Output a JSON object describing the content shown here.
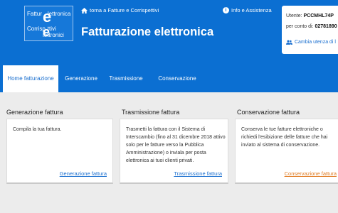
{
  "header": {
    "logo": {
      "line1": "Fattur",
      "line2": "lettronica",
      "line3": "Corrisp",
      "line4": "ttivi",
      "line5": "lettronici"
    },
    "back_link": "torna a Fatture e Corrispettivi",
    "title": "Fatturazione elettronica",
    "info_link": "Info e Assistenza",
    "user": {
      "label": "Utente:",
      "id": "PCCMHL74P",
      "on_behalf_label": "per conto di:",
      "on_behalf_id": "02781890",
      "change_user": "Cambia utenza di l"
    }
  },
  "nav": {
    "tabs": [
      {
        "label": "Home fatturazione",
        "active": true
      },
      {
        "label": "Generazione",
        "active": false
      },
      {
        "label": "Trasmissione",
        "active": false
      },
      {
        "label": "Conservazione",
        "active": false
      }
    ]
  },
  "sections": [
    {
      "title": "Generazione fattura",
      "text": "Compila la tua fattura.",
      "link": "Generazione fattura"
    },
    {
      "title": "Trasmissione fattura",
      "text": "Trasmetti la fattura con il Sistema di Interscambio (fino al 31 dicembre 2018 attivo solo per le fatture verso la Pubblica Amministrazione) o inviala per posta elettronica ai tuoi clienti privati.",
      "link": "Trasmissione fattura"
    },
    {
      "title": "Conservazione fattura",
      "text": "Conserva le tue fatture elettroniche o richiedi l'esibizione delle fatture che hai inviato al sistema di conservazione.",
      "link": "Conservazione fattura"
    }
  ],
  "colors": {
    "header_blue": "#0b6fd2",
    "link_blue": "#1a6fcf",
    "link_orange": "#e07a1f"
  },
  "icons": {
    "back": "home-icon",
    "info": "info-icon",
    "change_user": "users-icon"
  }
}
